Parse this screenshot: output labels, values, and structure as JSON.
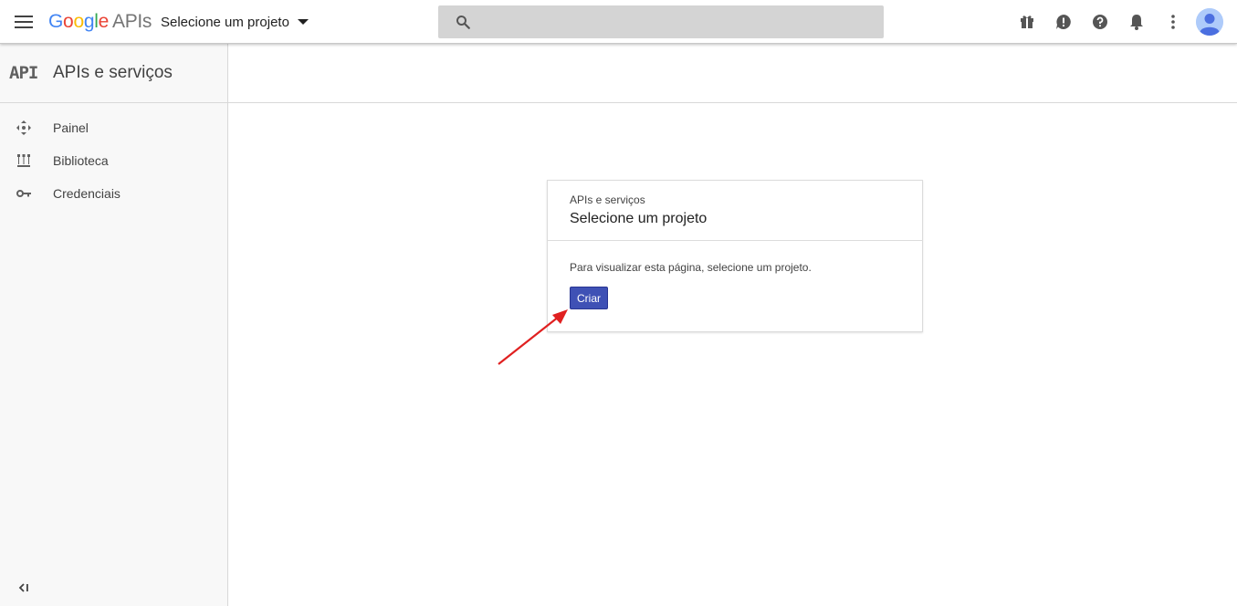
{
  "topbar": {
    "logo_google": [
      "G",
      "o",
      "o",
      "g",
      "l",
      "e"
    ],
    "logo_apis": "APIs",
    "project_picker_label": "Selecione um projeto",
    "search_placeholder": "",
    "icons": [
      "menu-icon",
      "search-icon",
      "gift-icon",
      "feedback-icon",
      "help-icon",
      "notifications-icon",
      "more-vert-icon",
      "account-avatar"
    ]
  },
  "sidebar": {
    "glyph": "API",
    "title": "APIs e serviços",
    "items": [
      {
        "label": "Painel",
        "icon": "dashboard-icon"
      },
      {
        "label": "Biblioteca",
        "icon": "library-icon"
      },
      {
        "label": "Credenciais",
        "icon": "key-icon"
      }
    ],
    "collapse_icon": "collapse-icon"
  },
  "card": {
    "overline": "APIs e serviços",
    "title": "Selecione um projeto",
    "message": "Para visualizar esta página, selecione um projeto.",
    "button_label": "Criar"
  },
  "colors": {
    "primary_button": "#3f51b5",
    "annotation_arrow": "#e02020",
    "sidebar_bg": "#f8f8f8",
    "search_bg": "#d4d4d4"
  }
}
